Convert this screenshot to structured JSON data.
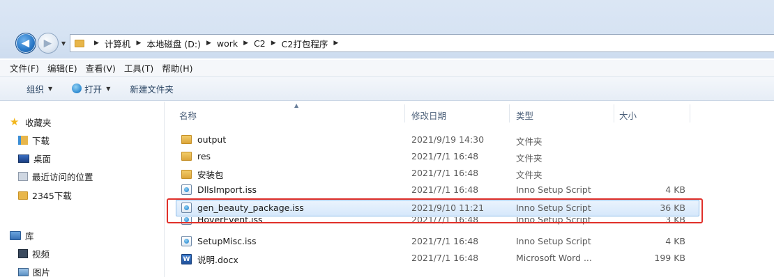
{
  "breadcrumb": [
    "计算机",
    "本地磁盘 (D:)",
    "work",
    "C2",
    "C2打包程序"
  ],
  "menu": [
    "文件(F)",
    "编辑(E)",
    "查看(V)",
    "工具(T)",
    "帮助(H)"
  ],
  "toolbar": {
    "organize": "组织",
    "open": "打开",
    "new_folder": "新建文件夹"
  },
  "nav": {
    "favorites": "收藏夹",
    "downloads": "下载",
    "desktop": "桌面",
    "recent": "最近访问的位置",
    "downloads2345": "2345下载",
    "libraries": "库",
    "videos": "视频",
    "pictures": "图片"
  },
  "columns": {
    "name": "名称",
    "date": "修改日期",
    "type": "类型",
    "size": "大小"
  },
  "files": [
    {
      "name": "output",
      "date": "2021/9/19 14:30",
      "type": "文件夹",
      "size": "",
      "icon": "folder-icon"
    },
    {
      "name": "res",
      "date": "2021/7/1 16:48",
      "type": "文件夹",
      "size": "",
      "icon": "folder-icon"
    },
    {
      "name": "安装包",
      "date": "2021/7/1 16:48",
      "type": "文件夹",
      "size": "",
      "icon": "folder-icon"
    },
    {
      "name": "DllsImport.iss",
      "date": "2021/7/1 16:48",
      "type": "Inno Setup Script",
      "size": "4 KB",
      "icon": "inno-script-icon"
    },
    {
      "name": "gen_beauty_package.iss",
      "date": "2021/9/10 11:21",
      "type": "Inno Setup Script",
      "size": "36 KB",
      "icon": "inno-script-icon"
    },
    {
      "name": "HoverEvent.iss",
      "date": "2021/7/1 16:48",
      "type": "Inno Setup Script",
      "size": "3 KB",
      "icon": "inno-script-icon"
    },
    {
      "name": "SetupMisc.iss",
      "date": "2021/7/1 16:48",
      "type": "Inno Setup Script",
      "size": "4 KB",
      "icon": "inno-script-icon"
    },
    {
      "name": "说明.docx",
      "date": "2021/7/1 16:48",
      "type": "Microsoft Word ...",
      "size": "199 KB",
      "icon": "word-doc-icon"
    }
  ],
  "colors": {
    "highlight": "#e0302a",
    "selection": "#d6e8fb"
  }
}
